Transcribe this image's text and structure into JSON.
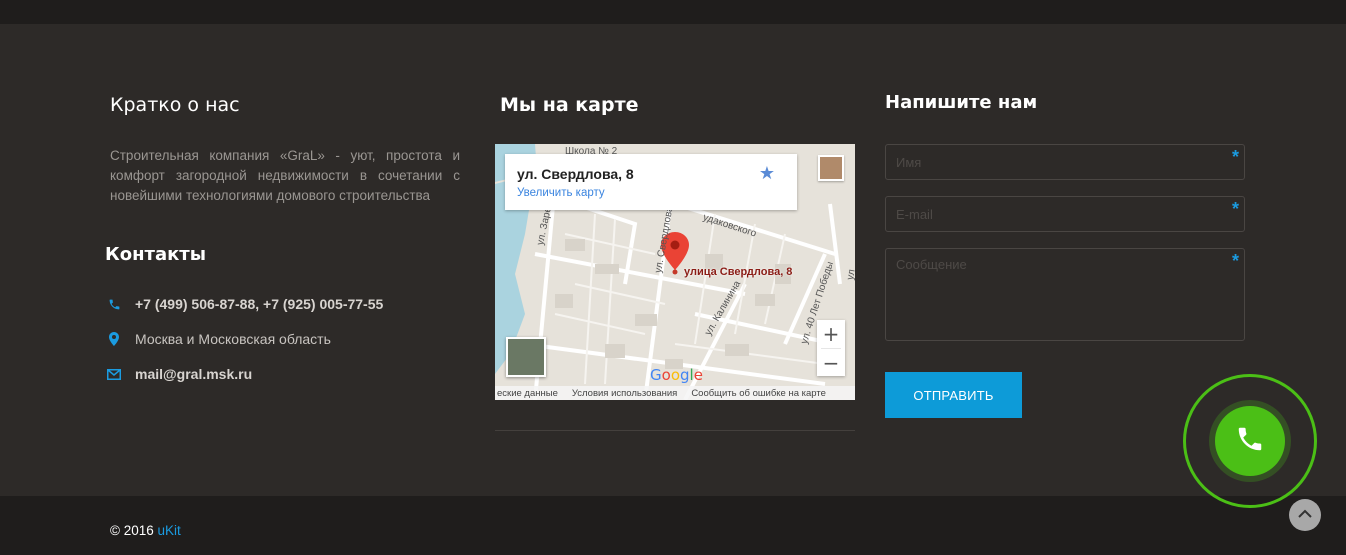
{
  "about": {
    "heading": "Кратко о нас",
    "text": "Строительная компания «GraL» - уют, простота и комфорт загородной недвижимости в сочетании с новейшими технологиями домового строительства"
  },
  "contacts": {
    "heading": "Контакты",
    "phone": "+7 (499) 506-87-88, +7 (925) 005-77-55",
    "address": "Москва и Московская область",
    "email": "mail@gral.msk.ru"
  },
  "map": {
    "heading": "Мы на карте",
    "card_address": "ул. Свердлова, 8",
    "card_enlarge": "Увеличить карту",
    "pin_label": "улица Свердлова, 8",
    "zoom_in": "+",
    "zoom_out": "−",
    "streets": {
      "s1": "ул. Заречная",
      "s2": "ул. Свердлова",
      "s3": "удаковского",
      "s4": "ул. Калинина",
      "s5": "ул. 40 Лет Победы",
      "s6": "Школа № 2",
      "s7": "ул"
    },
    "footer": {
      "data": "еские данные",
      "terms": "Условия использования",
      "report": "Сообщить об ошибке на карте"
    }
  },
  "form": {
    "heading": "Напишите нам",
    "name_placeholder": "Имя",
    "email_placeholder": "E-mail",
    "message_placeholder": "Сообщение",
    "required_mark": "*",
    "submit_label": "ОТПРАВИТЬ"
  },
  "copyright": {
    "text": "© 2016 ",
    "link": "uKit"
  },
  "colors": {
    "accent": "#0d9bd8",
    "callback_green": "#4bbf16",
    "background": "#2d2a28"
  }
}
